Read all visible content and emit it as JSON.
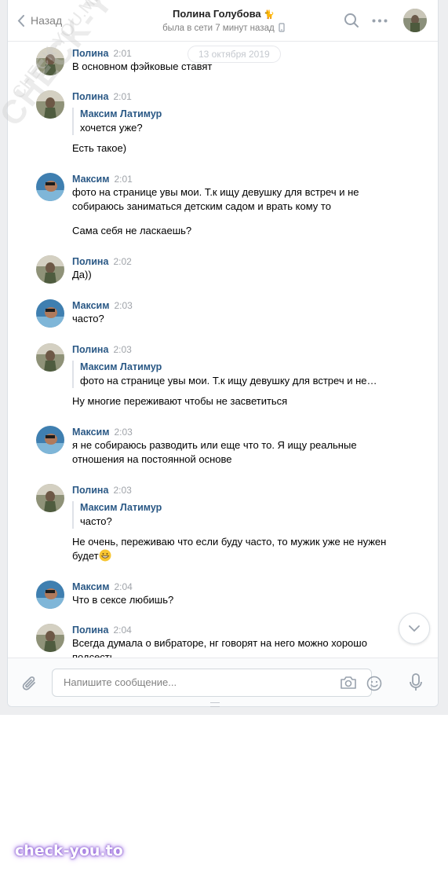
{
  "header": {
    "back_label": "Назад",
    "title": "Полина Голубова",
    "title_emoji": "🐈",
    "status": "была в сети 7 минут назад"
  },
  "date_divider": "13 октября 2019",
  "messages": [
    {
      "author": "Полина",
      "time": "2:01",
      "who": "polina",
      "text": "В основном фэйковые ставят"
    },
    {
      "author": "Полина",
      "time": "2:01",
      "who": "polina",
      "quote_author": "Максим Латимур",
      "quote_text": "хочется уже?",
      "text": "Есть такое)"
    },
    {
      "author": "Максим",
      "time": "2:01",
      "who": "maxim",
      "text": "фото на странице увы мои. Т.к ищу девушку для встреч и не собираюсь заниматься детским садом и врать кому то",
      "text2": "Сама себя не ласкаешь?"
    },
    {
      "author": "Полина",
      "time": "2:02",
      "who": "polina",
      "text": "Да))"
    },
    {
      "author": "Максим",
      "time": "2:03",
      "who": "maxim",
      "text": "часто?"
    },
    {
      "author": "Полина",
      "time": "2:03",
      "who": "polina",
      "quote_author": "Максим Латимур",
      "quote_text": "фото на странице увы мои. Т.к ищу девушку для встреч и не…",
      "text": "Ну многие переживают чтобы не засветиться"
    },
    {
      "author": "Максим",
      "time": "2:03",
      "who": "maxim",
      "text": "я не собираюсь разводить или еще что то. Я ищу реальные отношения на постоянной основе"
    },
    {
      "author": "Полина",
      "time": "2:03",
      "who": "polina",
      "quote_author": "Максим Латимур",
      "quote_text": "часто?",
      "text": "Не очень, переживаю что если буду часто, то мужик уже не нужен будет"
    },
    {
      "author": "Максим",
      "time": "2:04",
      "who": "maxim",
      "text": "Что в сексе любишь?"
    },
    {
      "author": "Полина",
      "time": "2:04",
      "who": "polina",
      "text": "Всегда думала о вибраторе, нг говорят на него можно хорошо подсесть"
    }
  ],
  "composer": {
    "placeholder": "Напишите сообщение..."
  },
  "watermarks": {
    "diagonal": "CHECK-YOU.ME",
    "small": "CHECK-YOU.ME",
    "brand": "check-you.to"
  },
  "colors": {
    "accent": "#2a5885",
    "page_bg": "#edeef0",
    "muted": "#828282"
  }
}
